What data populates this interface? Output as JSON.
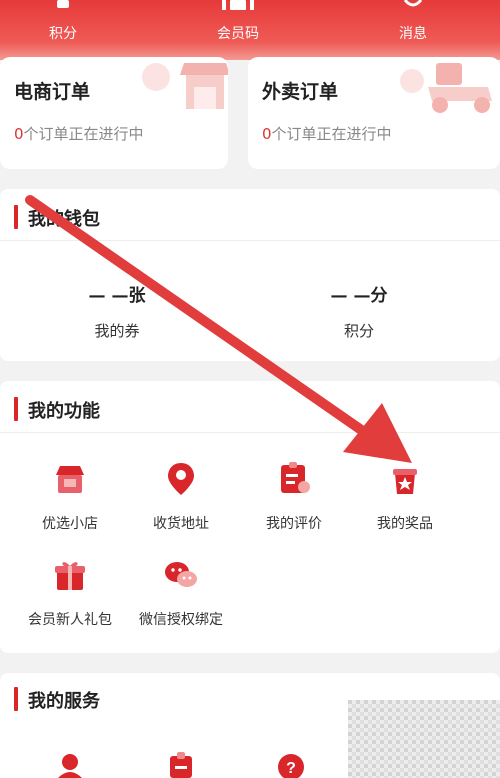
{
  "top_nav": {
    "items": [
      {
        "label": "积分",
        "icon": "points-icon"
      },
      {
        "label": "会员码",
        "icon": "qrcode-icon"
      },
      {
        "label": "消息",
        "icon": "message-icon"
      }
    ]
  },
  "orders": {
    "ecommerce": {
      "title": "电商订单",
      "count": "0",
      "status": "个订单正在进行中"
    },
    "takeout": {
      "title": "外卖订单",
      "count": "0",
      "status": "个订单正在进行中"
    }
  },
  "wallet": {
    "title": "我的钱包",
    "coupons": {
      "value": "— —张",
      "label": "我的券"
    },
    "points": {
      "value": "— —分",
      "label": "积分"
    }
  },
  "functions": {
    "title": "我的功能",
    "items": [
      {
        "label": "优选小店",
        "icon": "shop-icon"
      },
      {
        "label": "收货地址",
        "icon": "location-icon"
      },
      {
        "label": "我的评价",
        "icon": "review-icon"
      },
      {
        "label": "我的奖品",
        "icon": "prize-icon"
      },
      {
        "label": "会员新人礼包",
        "icon": "gift-icon"
      },
      {
        "label": "微信授权绑定",
        "icon": "wechat-icon"
      }
    ]
  },
  "services": {
    "title": "我的服务",
    "icons": [
      "person-icon",
      "clipboard-icon",
      "help-icon"
    ]
  },
  "colors": {
    "brand_red": "#d8262b",
    "header_red": "#e63a3a",
    "annotation_arrow": "#e23d3d"
  }
}
